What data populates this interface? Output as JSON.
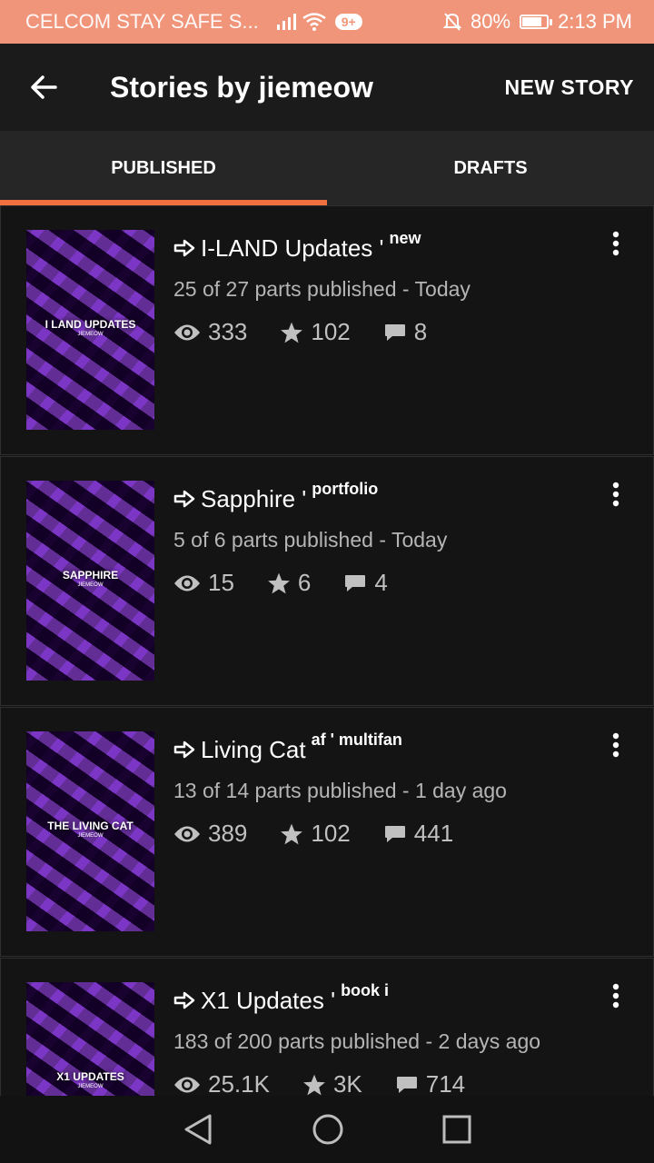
{
  "status_bar": {
    "carrier": "CELCOM STAY SAFE S...",
    "notif_count": "9+",
    "battery": "80%",
    "battery_level": 0.8,
    "time": "2:13 PM"
  },
  "app_bar": {
    "title": "Stories by jiemeow",
    "new_story_label": "NEW STORY"
  },
  "tabs": [
    {
      "label": "PUBLISHED",
      "active": true
    },
    {
      "label": "DRAFTS",
      "active": false
    }
  ],
  "stories": [
    {
      "title": "I-LAND Updates '",
      "tag": "new",
      "parts": "25 of 27 parts published - Today",
      "reads": "333",
      "votes": "102",
      "comments": "8",
      "cover_title": "I LAND UPDATES",
      "cover_author": "JIEMEOW"
    },
    {
      "title": "Sapphire '",
      "tag": "portfolio",
      "parts": "5 of 6 parts published - Today",
      "reads": "15",
      "votes": "6",
      "comments": "4",
      "cover_title": "SAPPHIRE",
      "cover_author": "JIEMEOW"
    },
    {
      "title": "Living Cat",
      "tag": "af ' multifan",
      "parts": "13 of 14 parts published - 1 day ago",
      "reads": "389",
      "votes": "102",
      "comments": "441",
      "cover_title": "THE LIVING CAT",
      "cover_author": "JIEMEOW"
    },
    {
      "title": "X1 Updates '",
      "tag": "book i",
      "parts": "183 of 200 parts published - 2 days ago",
      "reads": "25.1K",
      "votes": "3K",
      "comments": "714",
      "cover_title": "X1 UPDATES",
      "cover_author": "JIEMEOW"
    }
  ]
}
